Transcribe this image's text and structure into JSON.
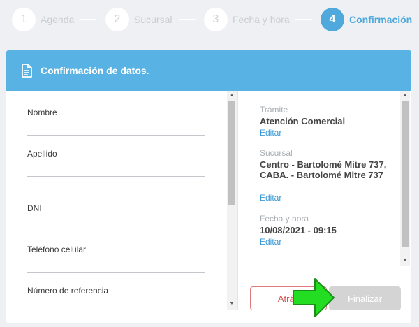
{
  "stepper": {
    "steps": [
      {
        "number": "1",
        "label": "Agenda"
      },
      {
        "number": "2",
        "label": "Sucursal"
      },
      {
        "number": "3",
        "label": "Fecha y hora"
      },
      {
        "number": "4",
        "label": "Confirmación"
      }
    ],
    "active_step": 4
  },
  "card": {
    "title": "Confirmación de datos.",
    "icon": "document-icon"
  },
  "form": {
    "fields": [
      {
        "label": "Nombre",
        "value": ""
      },
      {
        "label": "Apellido",
        "value": ""
      },
      {
        "label": "DNI",
        "value": ""
      },
      {
        "label": "Teléfono celular",
        "value": ""
      },
      {
        "label": "Número de referencia",
        "value": ""
      }
    ]
  },
  "summary": {
    "tramite_label": "Trámite",
    "tramite_value": "Atención Comercial",
    "sucursal_label": "Sucursal",
    "sucursal_value": "Centro - Bartolomé Mitre 737, CABA. - Bartolomé Mitre 737",
    "fecha_label": "Fecha y hora",
    "fecha_value": "10/08/2021 - 09:15",
    "edit_label": "Editar"
  },
  "buttons": {
    "back_label": "Atrás",
    "finish_label": "Finalizar"
  },
  "colors": {
    "accent": "#4fa9dc",
    "header": "#58b2e4",
    "link": "#3b9ad6",
    "danger": "#d9534f",
    "disabled": "#d4d4d4",
    "overlay_arrow": "#22dd22"
  }
}
